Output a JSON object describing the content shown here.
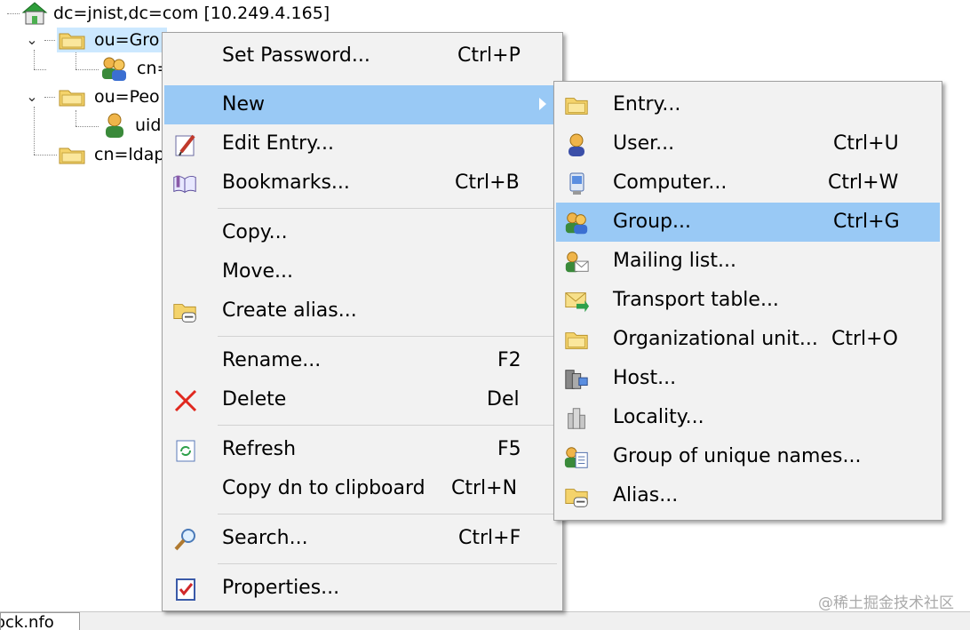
{
  "tree": {
    "root_label": "dc=jnist,dc=com [10.249.4.165]",
    "nodes": [
      {
        "label": "ou=Gro",
        "icon": "folder-icon"
      },
      {
        "label": "cn=",
        "icon": "group-icon"
      },
      {
        "label": "ou=Peo",
        "icon": "folder-icon"
      },
      {
        "label": "uid",
        "icon": "user-icon"
      },
      {
        "label": "cn=ldap",
        "icon": "folder-icon"
      }
    ]
  },
  "context_menu": {
    "items": [
      {
        "label": "Set Password...",
        "shortcut": "Ctrl+P"
      },
      {
        "label": "New",
        "shortcut": ""
      },
      {
        "label": "Edit Entry...",
        "shortcut": ""
      },
      {
        "label": "Bookmarks...",
        "shortcut": "Ctrl+B"
      },
      {
        "label": "Copy...",
        "shortcut": ""
      },
      {
        "label": "Move...",
        "shortcut": ""
      },
      {
        "label": "Create alias...",
        "shortcut": ""
      },
      {
        "label": "Rename...",
        "shortcut": "F2"
      },
      {
        "label": "Delete",
        "shortcut": "Del"
      },
      {
        "label": "Refresh",
        "shortcut": "F5"
      },
      {
        "label": "Copy dn to clipboard",
        "shortcut": "Ctrl+N"
      },
      {
        "label": "Search...",
        "shortcut": "Ctrl+F"
      },
      {
        "label": "Properties...",
        "shortcut": ""
      }
    ]
  },
  "new_submenu": {
    "items": [
      {
        "label": "Entry...",
        "shortcut": ""
      },
      {
        "label": "User...",
        "shortcut": "Ctrl+U"
      },
      {
        "label": "Computer...",
        "shortcut": "Ctrl+W"
      },
      {
        "label": "Group...",
        "shortcut": "Ctrl+G"
      },
      {
        "label": "Mailing list...",
        "shortcut": ""
      },
      {
        "label": "Transport table...",
        "shortcut": ""
      },
      {
        "label": "Organizational unit...",
        "shortcut": "Ctrl+O"
      },
      {
        "label": "Host...",
        "shortcut": ""
      },
      {
        "label": "Locality...",
        "shortcut": ""
      },
      {
        "label": "Group of unique names...",
        "shortcut": ""
      },
      {
        "label": "Alias...",
        "shortcut": ""
      }
    ]
  },
  "bottom_tab": {
    "label": "ock.nfo"
  },
  "watermark": "@稀土掘金技术社区",
  "colors": {
    "highlight": "#99c9f5",
    "tree_selection": "#cce8ff",
    "menu_bg": "#f2f2f2"
  }
}
